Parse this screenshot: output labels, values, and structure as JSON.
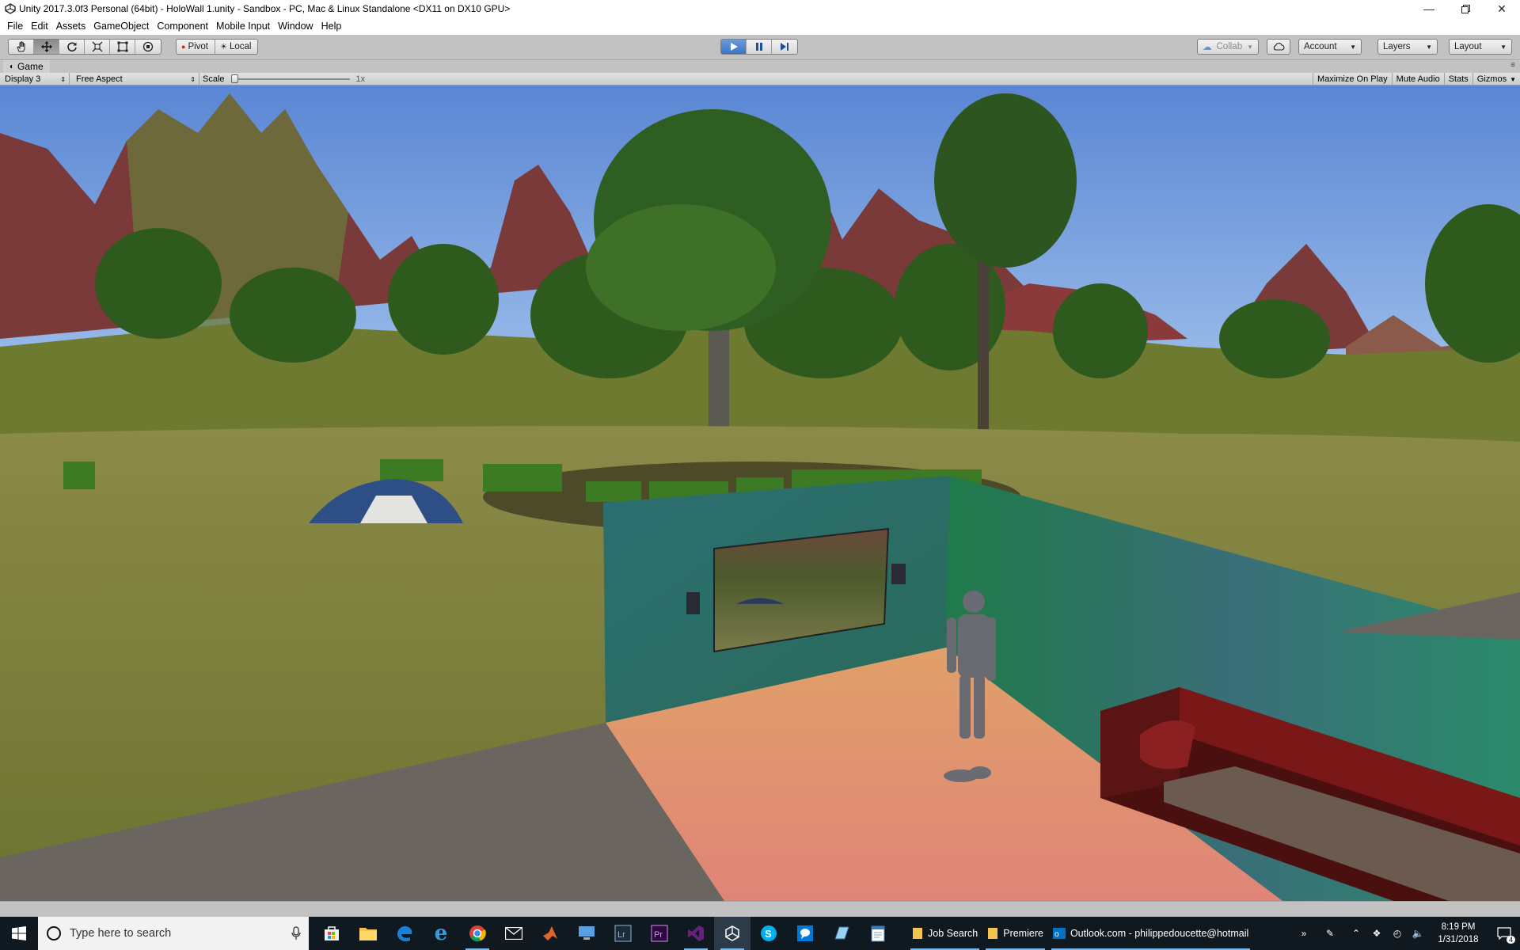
{
  "window": {
    "title": "Unity 2017.3.0f3 Personal (64bit) - HoloWall 1.unity - Sandbox - PC, Mac & Linux Standalone <DX11 on DX10 GPU>",
    "controls": [
      "minimize",
      "restore",
      "close"
    ]
  },
  "menubar": {
    "items": [
      "File",
      "Edit",
      "Assets",
      "GameObject",
      "Component",
      "Mobile Input",
      "Window",
      "Help"
    ]
  },
  "toolbar": {
    "tools": [
      "hand-tool",
      "move-tool",
      "rotate-tool",
      "scale-tool",
      "rect-tool",
      "transform-tool"
    ],
    "active_tool": "move-tool",
    "pivot_label": "Pivot",
    "local_label": "Local",
    "play_state": "playing",
    "collab_label": "Collab",
    "account_label": "Account",
    "layers_label": "Layers",
    "layout_label": "Layout"
  },
  "game_panel": {
    "tab_label": "Game",
    "display_label": "Display 3",
    "aspect_label": "Free Aspect",
    "scale_label": "Scale",
    "scale_value": "1x",
    "maximize_label": "Maximize On Play",
    "mute_label": "Mute Audio",
    "stats_label": "Stats",
    "gizmos_label": "Gizmos"
  },
  "scene": {
    "description_objects": [
      "mountains",
      "trees",
      "grass",
      "tent",
      "room-walls",
      "wall-screen",
      "speakers",
      "character",
      "sofa"
    ]
  },
  "taskbar": {
    "search_placeholder": "Type here to search",
    "pinned": [
      "store",
      "file-explorer",
      "edge",
      "internet-explorer",
      "chrome",
      "mail",
      "matlab",
      "remote-desktop",
      "lightroom",
      "premiere",
      "visual-studio",
      "unity",
      "skype",
      "messenger",
      "notepad-blue",
      "notepad"
    ],
    "tasks": [
      {
        "label": "Job Search",
        "icon": "folder"
      },
      {
        "label": "Premiere",
        "icon": "folder"
      },
      {
        "label": "Outlook.com - philippedoucette@hotmail",
        "icon": "outlook"
      }
    ],
    "time": "8:19 PM",
    "date": "1/31/2018",
    "notification_count": "4"
  },
  "colors": {
    "editor_bg": "#c2c2c2",
    "play_active": "#3a74c8",
    "taskbar_bg": "#101820",
    "sky": "#6e94d6",
    "grass": "#7b7a3c",
    "wall": "#2f7d6b",
    "floor": "#d98a6a",
    "sofa": "#6b1515"
  }
}
